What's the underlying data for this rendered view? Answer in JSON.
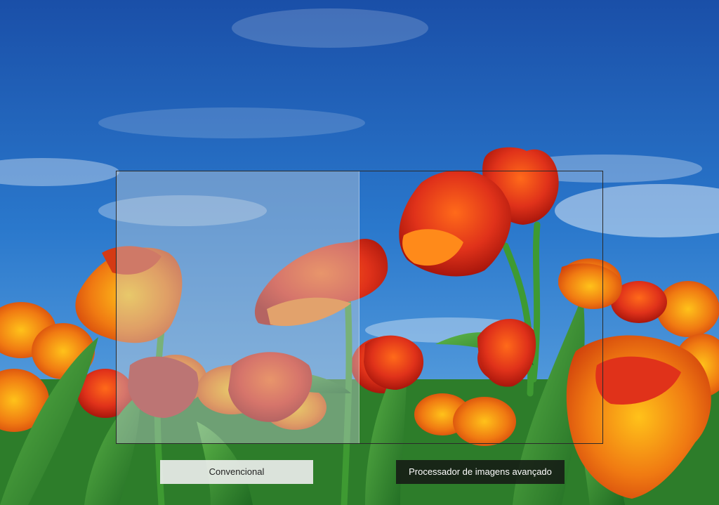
{
  "comparison": {
    "left_label": "Convencional",
    "right_label": "Processador de imagens avançado"
  },
  "colors": {
    "sky": "#1e5fb8",
    "tulip_red": "#e0321a",
    "tulip_orange": "#f07a12",
    "stem_green": "#2f8a2a"
  }
}
